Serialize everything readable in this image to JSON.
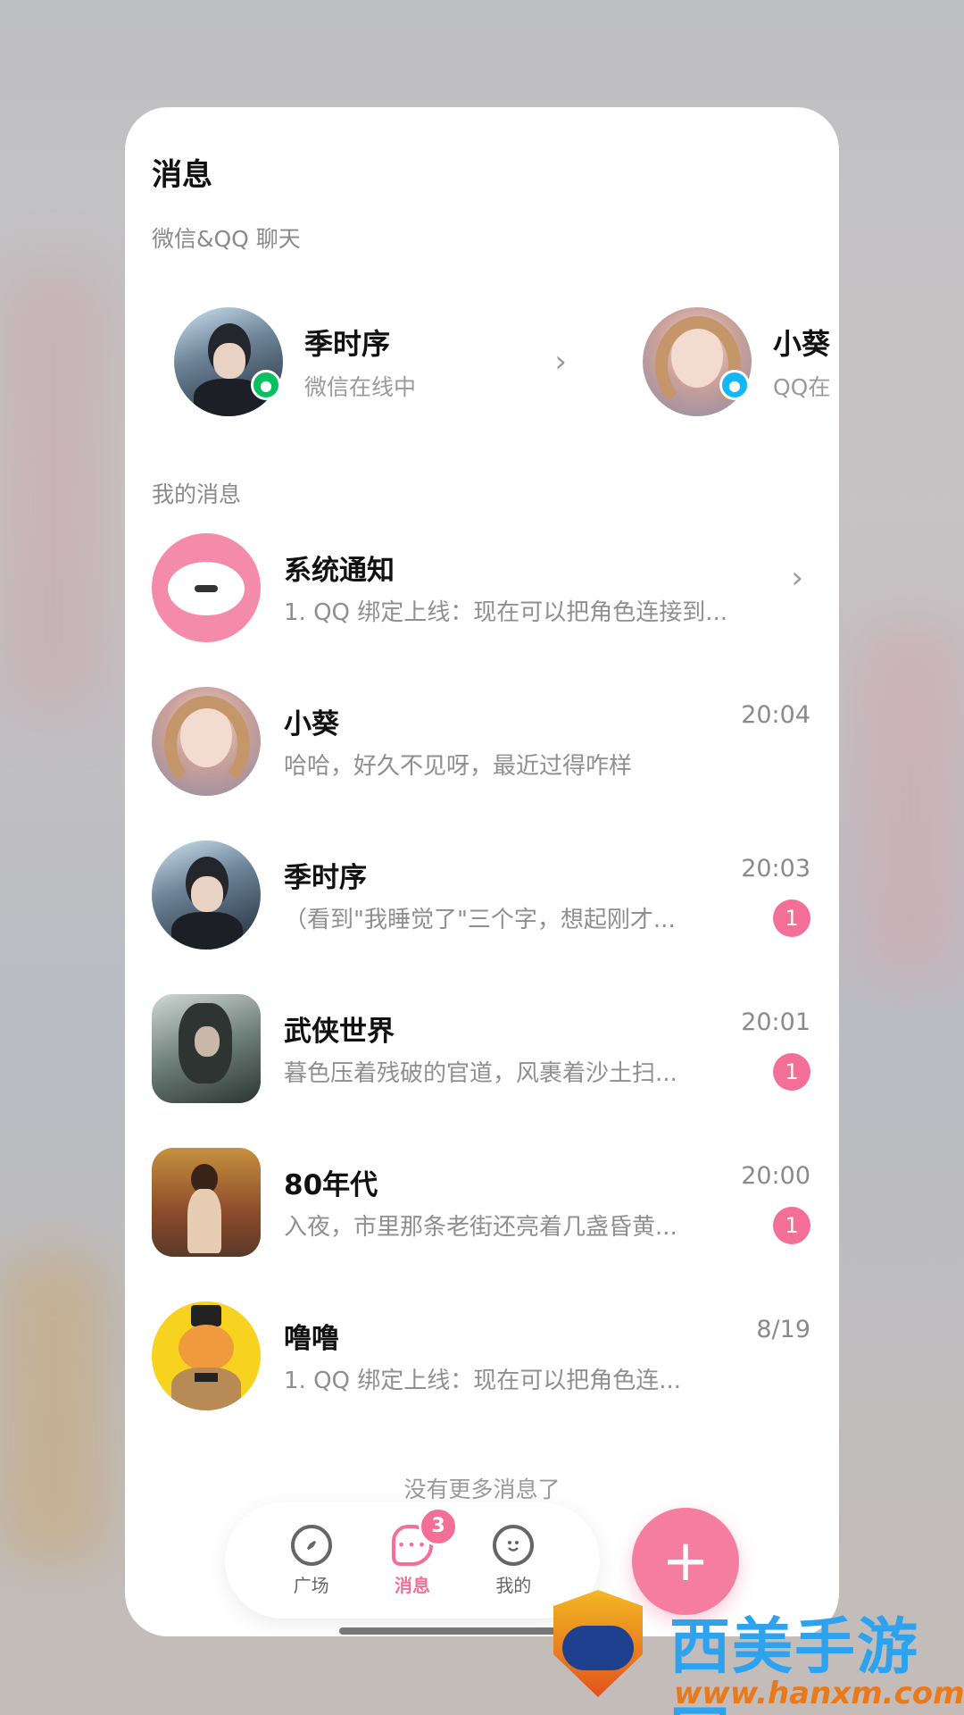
{
  "page": {
    "title": "消息",
    "wechat_qq_section": "微信&QQ 聊天",
    "my_messages_section": "我的消息",
    "no_more": "没有更多消息了"
  },
  "linked_chats": [
    {
      "name": "季时序",
      "status": "微信在线中",
      "platform": "wechat"
    },
    {
      "name": "小葵",
      "status": "QQ在",
      "platform": "qq"
    }
  ],
  "messages": [
    {
      "name": "系统通知",
      "preview": "1. QQ 绑定上线：现在可以把角色连接到...",
      "time": "",
      "unread": ""
    },
    {
      "name": "小葵",
      "preview": "哈哈，好久不见呀，最近过得咋样",
      "time": "20:04",
      "unread": ""
    },
    {
      "name": "季时序",
      "preview": "（看到\"我睡觉了\"三个字，想起刚才...",
      "time": "20:03",
      "unread": "1"
    },
    {
      "name": "武侠世界",
      "preview": "暮色压着残破的官道，风裹着沙土扫...",
      "time": "20:01",
      "unread": "1"
    },
    {
      "name": "80年代",
      "preview": "入夜，市里那条老街还亮着几盏昏黄...",
      "time": "20:00",
      "unread": "1"
    },
    {
      "name": "噜噜",
      "preview": "1. QQ 绑定上线：现在可以把角色连...",
      "time": "8/19",
      "unread": ""
    }
  ],
  "tabbar": {
    "tabs": [
      {
        "label": "广场",
        "icon": "compass-icon"
      },
      {
        "label": "消息",
        "icon": "chat-bubble-icon",
        "badge": "3"
      },
      {
        "label": "我的",
        "icon": "smiley-icon"
      }
    ],
    "fab_label": "+"
  },
  "watermark": {
    "text": "西美手游网",
    "url": "www.hanxm.com"
  },
  "colors": {
    "accent": "#f46f98",
    "wechat": "#07c160",
    "qq": "#12b7f5"
  }
}
